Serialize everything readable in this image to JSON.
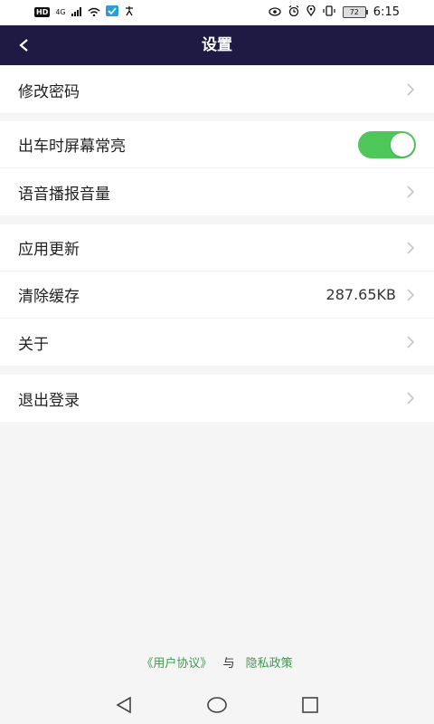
{
  "status_bar": {
    "hd": "HD",
    "network": "4G",
    "battery": "72",
    "time": "6:15"
  },
  "header": {
    "title": "设置"
  },
  "settings": {
    "change_password": "修改密码",
    "screen_on": "出车时屏幕常亮",
    "screen_on_enabled": true,
    "voice_volume": "语音播报音量",
    "app_update": "应用更新",
    "clear_cache": "清除缓存",
    "cache_size": "287.65KB",
    "about": "关于",
    "logout": "退出登录"
  },
  "footer": {
    "user_agreement": "《用户协议》",
    "and": "与",
    "privacy_policy": "隐私政策"
  },
  "colors": {
    "header_bg": "#1e1a44",
    "toggle_on": "#4fc65a",
    "link": "#3d9a4c"
  }
}
